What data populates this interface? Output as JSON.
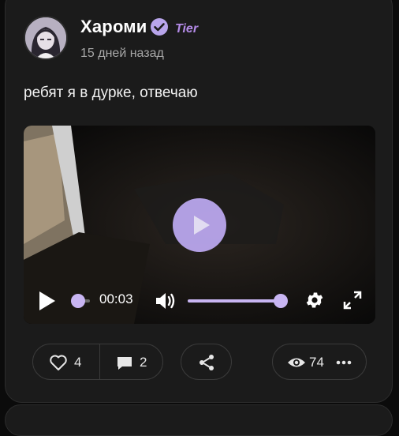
{
  "post": {
    "author": "Хароми",
    "tier_badge": "Tier",
    "date": "15 дней назад",
    "text": "ребят я в дурке, отвечаю"
  },
  "video": {
    "current_time": "00:03",
    "progress": 0.0,
    "volume": 1.0
  },
  "actions": {
    "likes": "4",
    "comments": "2",
    "views": "74"
  },
  "colors": {
    "accent": "#b8a5eb",
    "card_bg": "#1b1b1b",
    "page_bg": "#0b0b0b"
  }
}
